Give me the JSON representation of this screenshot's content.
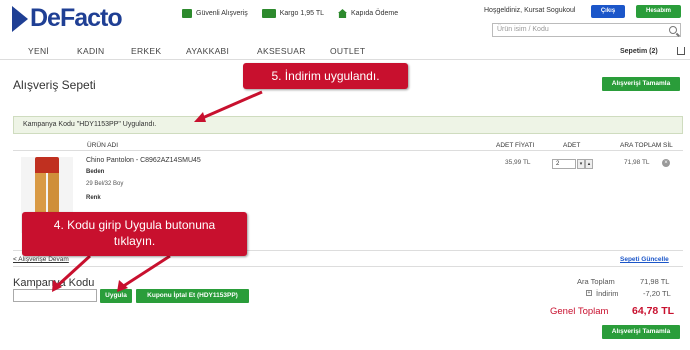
{
  "header": {
    "logo": "DeFacto",
    "perks": [
      "Güvenli Alışveriş",
      "Kargo 1,95 TL",
      "Kapıda Ödeme"
    ],
    "greeting": "Hoşgeldiniz, Kursat Sogukoul",
    "logout": "Çıkış",
    "account": "Hesabım",
    "search_placeholder": "Ürün isim / Kodu"
  },
  "nav": {
    "items": [
      "YENİ",
      "KADIN",
      "ERKEK",
      "AYAKKABI",
      "AKSESUAR",
      "OUTLET"
    ],
    "cart": "Sepetim (2)"
  },
  "page": {
    "title": "Alışveriş Sepeti",
    "complete_button": "Alışverişi Tamamla",
    "notice": "Kampanya Kodu \"HDY1153PP\" Uygulandı."
  },
  "table": {
    "headers": [
      "ÜRÜN ADI",
      "ADET FİYATI",
      "ADET",
      "ARA TOPLAM",
      "SİL"
    ],
    "row": {
      "name": "Chino Pantolon - C8962AZ14SMU45",
      "size_label": "Beden",
      "size_value": "29 Bel/32 Boy",
      "color_label": "Renk",
      "unit_price": "35,99 TL",
      "quantity": "2",
      "subtotal": "71,98 TL"
    }
  },
  "links": {
    "continue": "< Alışverişe Devam",
    "update": "Sepeti Güncelle"
  },
  "coupon": {
    "label": "Kampanya Kodu",
    "apply_button": "Uygula",
    "cancel_button": "Kuponu İptal Et (HDY1153PP)"
  },
  "summary": {
    "subtotal_label": "Ara Toplam",
    "subtotal_value": "71,98 TL",
    "discount_label": "İndirim",
    "discount_value": "-7,20 TL",
    "total_label": "Genel Toplam",
    "total_value": "64,78 TL"
  },
  "annotations": {
    "step5": "5. İndirim uygulandı.",
    "step4_line1": "4. Kodu girip Uygula butonuna",
    "step4_line2": "tıklayın."
  },
  "colors": {
    "brand_blue": "#1f3f94",
    "green": "#2a9d3a",
    "red": "#c8102e"
  }
}
